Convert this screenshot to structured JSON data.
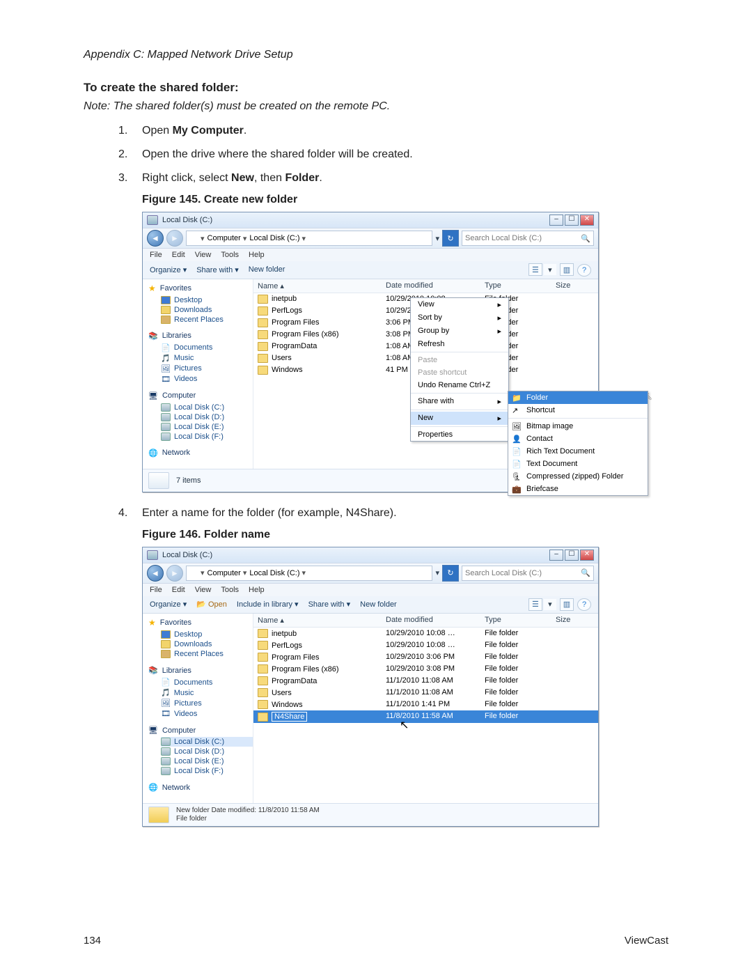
{
  "header_line": "Appendix C: Mapped Network Drive Setup",
  "section_title": "To create the shared folder:",
  "note": "Note: The shared folder(s) must be created on the remote PC.",
  "steps": {
    "s1_pref": "Open ",
    "s1_bold": "My Computer",
    "s1_suf": ".",
    "s2": "Open the drive where the shared folder will be created.",
    "s3_pref": "Right click, select ",
    "s3_b1": "New",
    "s3_mid": ", then ",
    "s3_b2": "Folder",
    "s3_suf": ".",
    "s4": "Enter a name for the folder (for example, N4Share)."
  },
  "figcap_145": "Figure 145. Create new folder",
  "figcap_146": "Figure 146. Folder name",
  "win_title": "Local Disk (C:)",
  "breadcrumb": {
    "seg1": "Computer",
    "seg2": "Local Disk (C:)"
  },
  "search_placeholder": "Search Local Disk (C:)",
  "menu": [
    "File",
    "Edit",
    "View",
    "Tools",
    "Help"
  ],
  "toolbar1": {
    "organize": "Organize",
    "share": "Share with",
    "newfolder": "New folder"
  },
  "toolbar2": {
    "organize": "Organize",
    "open": "Open",
    "include": "Include in library",
    "share": "Share with",
    "newfolder": "New folder"
  },
  "nav": {
    "fav_hdr": "Favorites",
    "fav": [
      "Desktop",
      "Downloads",
      "Recent Places"
    ],
    "lib_hdr": "Libraries",
    "lib": [
      "Documents",
      "Music",
      "Pictures",
      "Videos"
    ],
    "comp_hdr": "Computer",
    "drives": [
      "Local Disk (C:)",
      "Local Disk (D:)",
      "Local Disk (E:)",
      "Local Disk (F:)"
    ],
    "net_hdr": "Network"
  },
  "cols": {
    "name": "Name",
    "date": "Date modified",
    "type": "Type",
    "size": "Size"
  },
  "rows145": [
    {
      "name": "inetpub",
      "date": "10/29/2010 10:08 …",
      "type": "File folder"
    },
    {
      "name": "PerfLogs",
      "date": "10/29/2010 10:08 …",
      "type": "File folder"
    },
    {
      "name": "Program Files",
      "date": "3:06 PM",
      "type": "File folder"
    },
    {
      "name": "Program Files (x86)",
      "date": "3:08 PM",
      "type": "File folder"
    },
    {
      "name": "ProgramData",
      "date": "1:08 AM",
      "type": "File folder"
    },
    {
      "name": "Users",
      "date": "1:08 AM",
      "type": "File folder"
    },
    {
      "name": "Windows",
      "date": "41 PM",
      "type": "File folder"
    }
  ],
  "ctx": {
    "view": "View",
    "sort": "Sort by",
    "group": "Group by",
    "refresh": "Refresh",
    "paste": "Paste",
    "pasteshort": "Paste shortcut",
    "undo": "Undo Rename   Ctrl+Z",
    "sharewith": "Share with",
    "new": "New",
    "properties": "Properties"
  },
  "newmenu": [
    "Folder",
    "Shortcut",
    "Bitmap image",
    "Contact",
    "Rich Text Document",
    "Text Document",
    "Compressed (zipped) Folder",
    "Briefcase"
  ],
  "rows146": [
    {
      "name": "inetpub",
      "date": "10/29/2010 10:08 …",
      "type": "File folder"
    },
    {
      "name": "PerfLogs",
      "date": "10/29/2010 10:08 …",
      "type": "File folder"
    },
    {
      "name": "Program Files",
      "date": "10/29/2010 3:06 PM",
      "type": "File folder"
    },
    {
      "name": "Program Files (x86)",
      "date": "10/29/2010 3:08 PM",
      "type": "File folder"
    },
    {
      "name": "ProgramData",
      "date": "11/1/2010 11:08 AM",
      "type": "File folder"
    },
    {
      "name": "Users",
      "date": "11/1/2010 11:08 AM",
      "type": "File folder"
    },
    {
      "name": "Windows",
      "date": "11/1/2010 1:41 PM",
      "type": "File folder"
    },
    {
      "name": "N4Share",
      "date": "11/8/2010 11:58 AM",
      "type": "File folder"
    }
  ],
  "status145": "7 items",
  "status146_l1": "New folder   Date modified: 11/8/2010 11:58 AM",
  "status146_l2": "File folder",
  "footer": {
    "page": "134",
    "brand": "ViewCast"
  }
}
